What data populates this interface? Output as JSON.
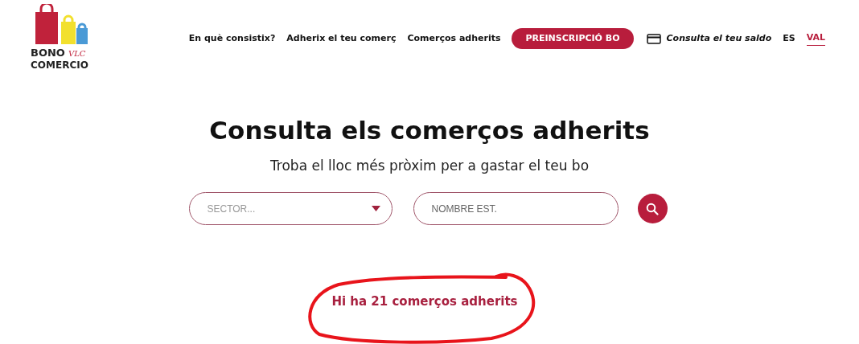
{
  "logo": {
    "line_1": "BONO",
    "tag": "VLC",
    "line_2": "COMERCIO"
  },
  "nav": {
    "links": [
      "En què consistix?",
      "Adherix el teu comerç",
      "Comerços adherits"
    ],
    "cta": "PREINSCRIPCIÓ BO",
    "balance": "Consulta el teu saldo",
    "languages": [
      {
        "label": "ES",
        "selected": false
      },
      {
        "label": "VAL",
        "selected": true
      }
    ]
  },
  "title": "Consulta els comerços adherits",
  "subtitle": "Troba el lloc més pròxim per a gastar el teu bo",
  "search": {
    "sector_placeholder": "SECTOR...",
    "name_placeholder": "NOMBRE EST."
  },
  "result": "Hi ha 21 comerços adherits"
}
